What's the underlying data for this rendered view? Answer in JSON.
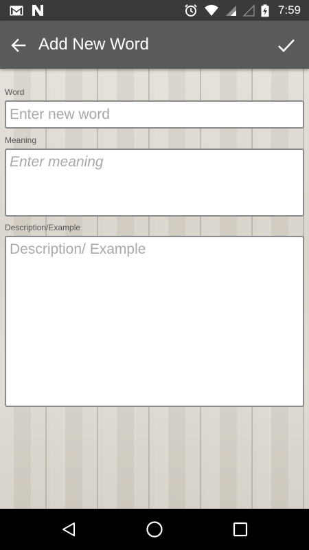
{
  "status_bar": {
    "time": "7:59",
    "left_icons": [
      "gmail-icon",
      "n-notification-icon"
    ],
    "right_icons": [
      "alarm-clock-icon",
      "wifi-icon",
      "cell-signal-icon",
      "cell-signal-empty-icon",
      "battery-charging-icon"
    ]
  },
  "app_bar": {
    "title": "Add New Word",
    "back_icon": "arrow-left-icon",
    "confirm_icon": "checkmark-icon",
    "background": "#5a5a5a"
  },
  "form": {
    "word": {
      "label": "Word",
      "placeholder": "Enter new word",
      "value": ""
    },
    "meaning": {
      "label": "Meaning",
      "placeholder": "Enter meaning",
      "value": ""
    },
    "description": {
      "label": "Description/Example",
      "placeholder": "Description/ Example",
      "value": ""
    }
  },
  "nav_bar": {
    "buttons": [
      "back-triangle-icon",
      "home-circle-icon",
      "recents-square-icon"
    ]
  }
}
